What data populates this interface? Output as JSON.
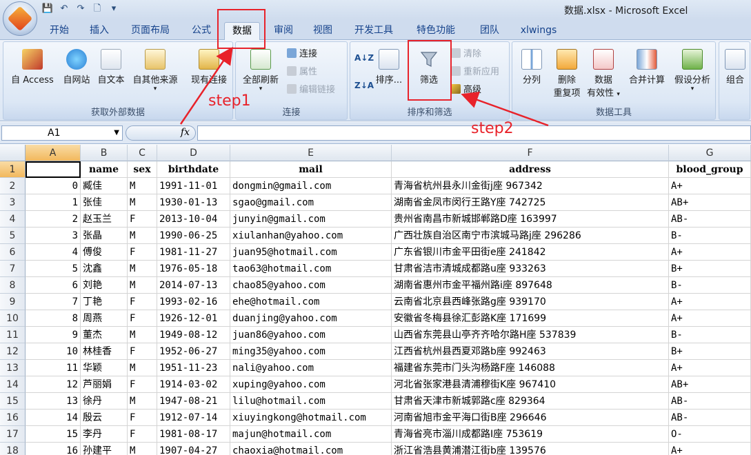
{
  "window": {
    "title": "数据.xlsx - Microsoft Excel"
  },
  "qat": {
    "save": "💾",
    "undo": "↶",
    "redo": "↷",
    "new": "🗋",
    "more": "▾"
  },
  "tabs": [
    "开始",
    "插入",
    "页面布局",
    "公式",
    "数据",
    "审阅",
    "视图",
    "开发工具",
    "特色功能",
    "团队",
    "xlwings"
  ],
  "active_tab": "数据",
  "ribbon": {
    "get_external": {
      "label": "获取外部数据",
      "buttons": [
        "自 Access",
        "自网站",
        "自文本",
        "自其他来源",
        "现有连接"
      ]
    },
    "connections": {
      "label": "连接",
      "refresh_all": "全部刷新",
      "connect": "连接",
      "properties": "属性",
      "edit_links": "编辑链接"
    },
    "sort_filter": {
      "label": "排序和筛选",
      "sort": "排序...",
      "filter": "筛选",
      "clear": "清除",
      "reapply": "重新应用",
      "advanced": "高级"
    },
    "data_tools": {
      "label": "数据工具",
      "split": "分列",
      "remove_dup_1": "删除",
      "remove_dup_2": "重复项",
      "validate_1": "数据",
      "validate_2": "有效性",
      "consolidate": "合并计算",
      "whatif": "假设分析"
    },
    "outline": {
      "group": "组合"
    }
  },
  "formula_bar": {
    "cell_ref": "A1",
    "fx": "fx",
    "value": ""
  },
  "grid": {
    "columns": [
      "A",
      "B",
      "C",
      "D",
      "E",
      "F",
      "G"
    ],
    "header_row": [
      "",
      "name",
      "sex",
      "birthdate",
      "mail",
      "address",
      "blood_group"
    ],
    "rows": [
      [
        "0",
        "臧佳",
        "M",
        "1991-11-01",
        "dongmin@gmail.com",
        "青海省杭州县永川金街j座 967342",
        "A+"
      ],
      [
        "1",
        "张佳",
        "M",
        "1930-01-13",
        "sgao@gmail.com",
        "湖南省金凤市闵行王路Y座 742725",
        "AB+"
      ],
      [
        "2",
        "赵玉兰",
        "F",
        "2013-10-04",
        "junyin@gmail.com",
        "贵州省南昌市新城邯郸路D座 163997",
        "AB-"
      ],
      [
        "3",
        "张晶",
        "M",
        "1990-06-25",
        "xiulanhan@yahoo.com",
        "广西壮族自治区南宁市滨城马路j座 296286",
        "B-"
      ],
      [
        "4",
        "傅俊",
        "F",
        "1981-11-27",
        "juan95@hotmail.com",
        "广东省银川市金平田街e座 241842",
        "A+"
      ],
      [
        "5",
        "沈鑫",
        "M",
        "1976-05-18",
        "tao63@hotmail.com",
        "甘肃省洁市清城成都路u座 933263",
        "B+"
      ],
      [
        "6",
        "刘艳",
        "M",
        "2014-07-13",
        "chao85@yahoo.com",
        "湖南省惠州市金平福州路i座 897648",
        "B-"
      ],
      [
        "7",
        "丁艳",
        "F",
        "1993-02-16",
        "ehe@hotmail.com",
        "云南省北京县西峰张路g座 939170",
        "A+"
      ],
      [
        "8",
        "周燕",
        "F",
        "1926-12-01",
        "duanjing@yahoo.com",
        "安徽省冬梅县徐汇彭路K座 171699",
        "A+"
      ],
      [
        "9",
        "董杰",
        "M",
        "1949-08-12",
        "juan86@yahoo.com",
        "山西省东莞县山亭齐齐哈尔路H座 537839",
        "B-"
      ],
      [
        "10",
        "林桂香",
        "F",
        "1952-06-27",
        "ming35@yahoo.com",
        "江西省杭州县西夏邓路b座 992463",
        "B+"
      ],
      [
        "11",
        "华颖",
        "M",
        "1951-11-23",
        "nali@yahoo.com",
        "福建省东莞市门头沟杨路F座 146088",
        "A+"
      ],
      [
        "12",
        "芦丽娟",
        "F",
        "1914-03-02",
        "xuping@yahoo.com",
        "河北省张家港县清浦穆街K座 967410",
        "AB+"
      ],
      [
        "13",
        "徐丹",
        "M",
        "1947-08-21",
        "lilu@hotmail.com",
        "甘肃省天津市新城郭路c座 829364",
        "AB-"
      ],
      [
        "14",
        "殷云",
        "F",
        "1912-07-14",
        "xiuyingkong@hotmail.com",
        "河南省旭市金平海口街B座 296646",
        "AB-"
      ],
      [
        "15",
        "李丹",
        "F",
        "1981-08-17",
        "majun@hotmail.com",
        "青海省亮市淄川成都路I座 753619",
        "O-"
      ],
      [
        "16",
        "孙建平",
        "M",
        "1907-04-27",
        "chaoxia@hotmail.com",
        "浙江省浩县黄浦潜江街b座 139576",
        "A+"
      ]
    ]
  },
  "annotations": {
    "step1": "step1",
    "step2": "step2",
    "color": "#e8222a"
  }
}
